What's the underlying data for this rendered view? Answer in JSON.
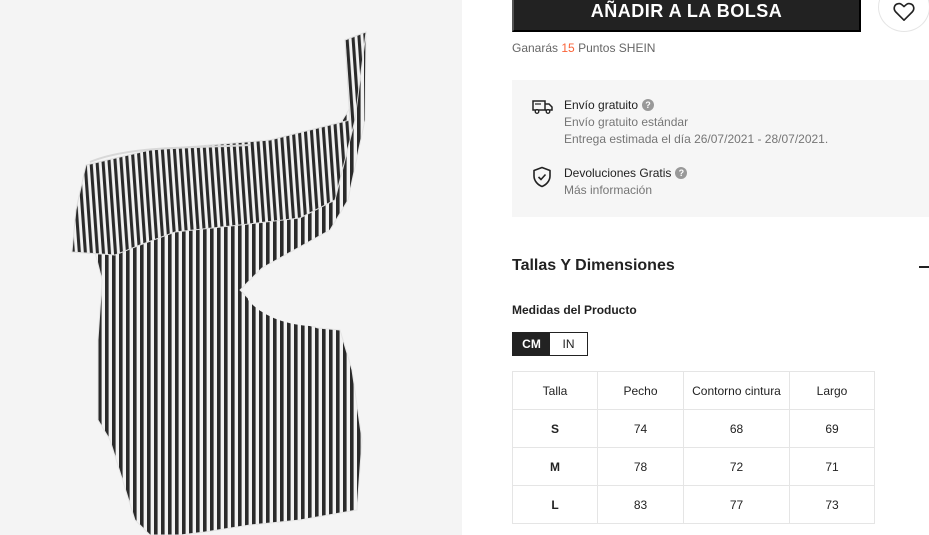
{
  "purchase": {
    "add_to_bag_label": "AÑADIR A LA BOLSA"
  },
  "points": {
    "prefix": "Ganarás",
    "value": "15",
    "suffix": "Puntos SHEIN"
  },
  "shipping": {
    "title": "Envío gratuito",
    "subtitle": "Envío gratuito estándar",
    "estimate": "Entrega estimada el día 26/07/2021 - 28/07/2021.",
    "help_glyph": "?"
  },
  "returns": {
    "title": "Devoluciones Gratis",
    "link": "Más información",
    "help_glyph": "?"
  },
  "size_section": {
    "heading": "Tallas Y Dimensiones",
    "measures_label": "Medidas del Producto",
    "units": [
      "CM",
      "IN"
    ],
    "active_unit": "CM",
    "table": {
      "headers": [
        "Talla",
        "Pecho",
        "Contorno cintura",
        "Largo"
      ],
      "rows": [
        [
          "S",
          "74",
          "68",
          "69"
        ],
        [
          "M",
          "78",
          "72",
          "71"
        ],
        [
          "L",
          "83",
          "77",
          "73"
        ]
      ]
    }
  },
  "icons": {
    "truck": "truck-icon",
    "shield": "shield-check-icon",
    "heart": "heart-icon",
    "collapse": "minus-icon"
  },
  "colors": {
    "accent": "#fa6338",
    "button": "#222222",
    "info_bg": "#f6f6f6"
  }
}
